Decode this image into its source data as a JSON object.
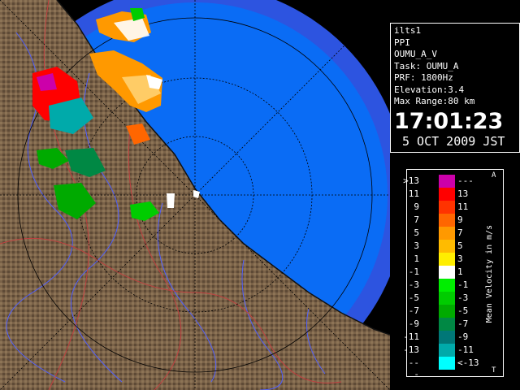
{
  "info": {
    "lines": [
      "ilts1",
      "PPI",
      "OUMU_A_V",
      "Task: OUMU_A",
      "PRF: 1800Hz",
      "Elevation:3.4",
      "Max Range:80 km"
    ],
    "time": "17:01:23",
    "date": "5 OCT 2009 JST"
  },
  "legend": {
    "title": "Mean Velocity in m/s",
    "cap_top": "A",
    "cap_bot": "T",
    "rows": [
      {
        "lo": ">13",
        "hi": "---",
        "color": "#cc00aa"
      },
      {
        "lo": "11",
        "hi": "13",
        "color": "#ff0000"
      },
      {
        "lo": "9",
        "hi": "11",
        "color": "#ff3300"
      },
      {
        "lo": "7",
        "hi": "9",
        "color": "#ff6600"
      },
      {
        "lo": "5",
        "hi": "7",
        "color": "#ff9900"
      },
      {
        "lo": "3",
        "hi": "5",
        "color": "#ffbb00"
      },
      {
        "lo": "1",
        "hi": "3",
        "color": "#ffee00"
      },
      {
        "lo": "-1",
        "hi": "1",
        "color": "#ffffff"
      },
      {
        "lo": "-3",
        "hi": "-1",
        "color": "#00ee00"
      },
      {
        "lo": "-5",
        "hi": "-3",
        "color": "#00cc00"
      },
      {
        "lo": "-7",
        "hi": "-5",
        "color": "#00aa00"
      },
      {
        "lo": "-9",
        "hi": "-7",
        "color": "#008844"
      },
      {
        "lo": "-11",
        "hi": "-9",
        "color": "#007777"
      },
      {
        "lo": "-13",
        "hi": "-11",
        "color": "#00aaaa"
      },
      {
        "lo": "---",
        "hi": "<-13",
        "color": "#00ffff"
      }
    ]
  },
  "colors": {
    "sea": "#0a6cf5",
    "sea_outer": "#2d54e0",
    "land": "#7a6248",
    "land_dark": "#5a4633",
    "rivers": "#5060ff",
    "boundaries": "#c04040"
  }
}
